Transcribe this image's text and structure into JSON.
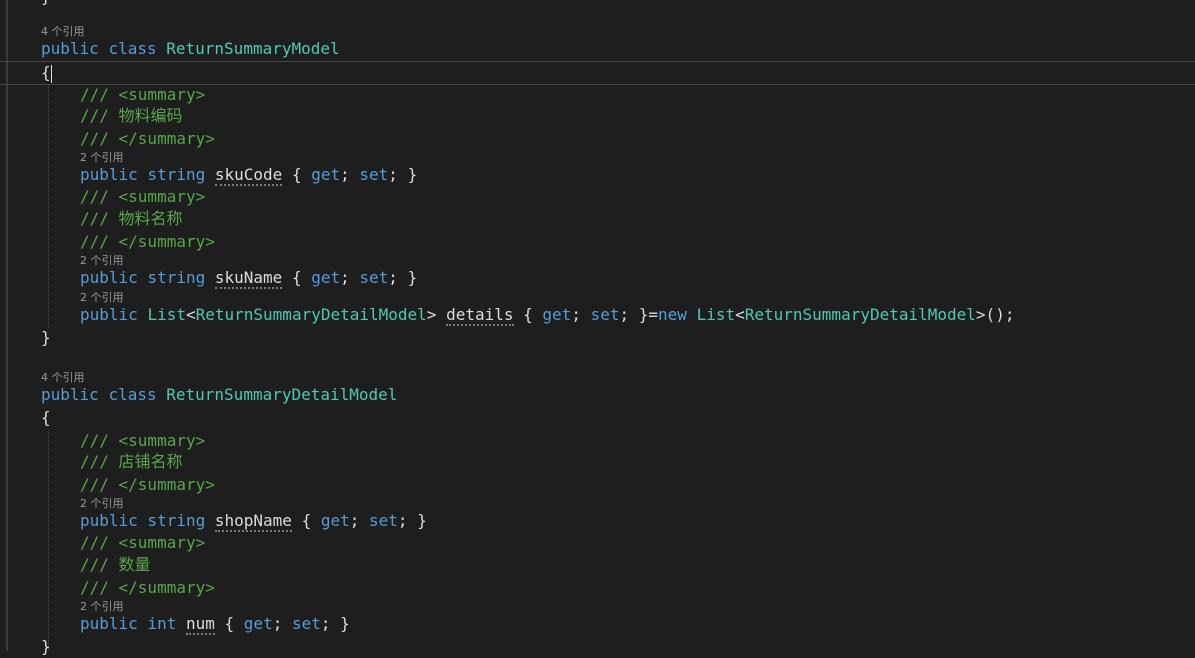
{
  "editor": {
    "class1": {
      "refs": "4 个引用",
      "decl": {
        "mod": "public",
        "kw": "class",
        "name": "ReturnSummaryModel"
      },
      "open": "{",
      "close": "}",
      "doc_open": "/// <summary>",
      "doc_close": "/// </summary>",
      "doc1": "/// 物料编码",
      "prop1": {
        "refs": "2 个引用",
        "mod": "public",
        "type": "string",
        "name": "skuCode"
      },
      "doc2": "/// 物料名称",
      "prop2": {
        "refs": "2 个引用",
        "mod": "public",
        "type": "string",
        "name": "skuName"
      },
      "prop3": {
        "refs": "2 个引用",
        "mod": "public",
        "list": "List",
        "generic": "ReturnSummaryDetailModel",
        "name": "details",
        "new_kw": "new"
      }
    },
    "class2": {
      "refs": "4 个引用",
      "decl": {
        "mod": "public",
        "kw": "class",
        "name": "ReturnSummaryDetailModel"
      },
      "doc1": "/// 店铺名称",
      "prop1": {
        "refs": "2 个引用",
        "mod": "public",
        "type": "string",
        "name": "shopName"
      },
      "doc2": "/// 数量",
      "prop2": {
        "refs": "2 个引用",
        "mod": "public",
        "type": "int",
        "name": "num"
      }
    },
    "accessor": {
      "get": "get",
      "set": "set"
    }
  }
}
